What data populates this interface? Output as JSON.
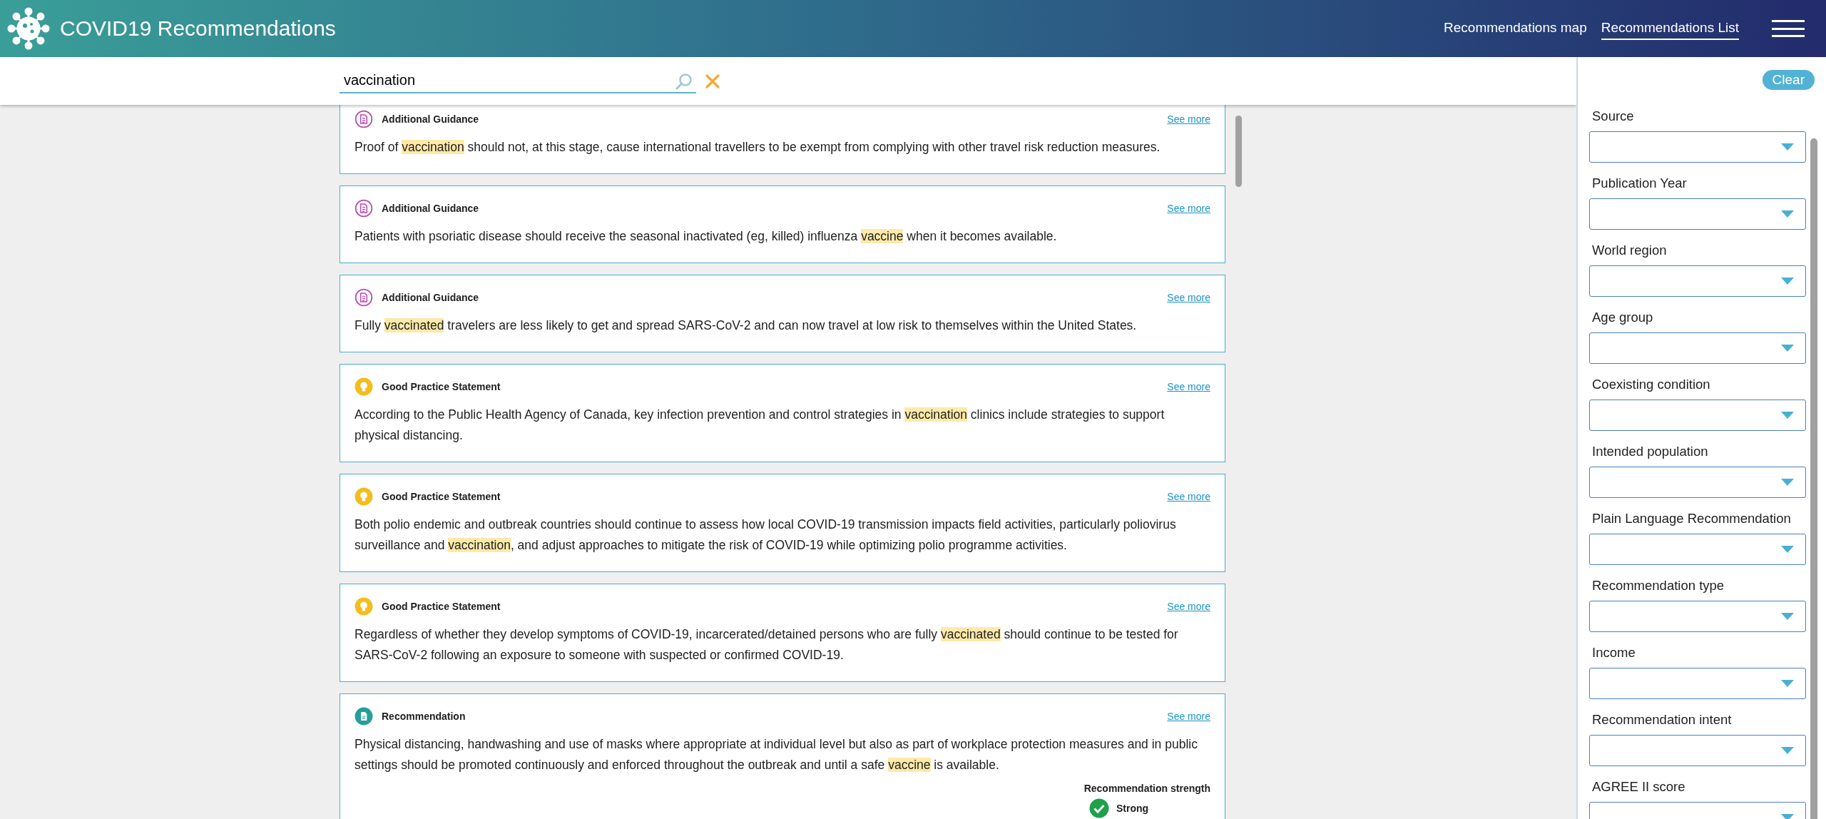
{
  "header": {
    "title": "COVID19 Recommendations",
    "nav": [
      {
        "label": "Recommendations map",
        "selected": false
      },
      {
        "label": "Recommendations List",
        "selected": true
      }
    ]
  },
  "search": {
    "value": "vaccination"
  },
  "cards": [
    {
      "kind": "additional_guidance",
      "type_label": "Additional Guidance",
      "link": "See more",
      "segments": [
        {
          "text": "Proof of ",
          "highlighted": false
        },
        {
          "text": "vaccination",
          "highlighted": true
        },
        {
          "text": " should not, at this stage, cause international travellers to be exempt from complying with other travel risk reduction measures.",
          "highlighted": false
        }
      ]
    },
    {
      "kind": "additional_guidance",
      "type_label": "Additional Guidance",
      "link": "See more",
      "segments": [
        {
          "text": "Patients with psoriatic disease should receive the seasonal inactivated (eg, killed) influenza ",
          "highlighted": false
        },
        {
          "text": "vaccine",
          "highlighted": true
        },
        {
          "text": " when it becomes available.",
          "highlighted": false
        }
      ]
    },
    {
      "kind": "additional_guidance",
      "type_label": "Additional Guidance",
      "link": "See more",
      "segments": [
        {
          "text": "Fully ",
          "highlighted": false
        },
        {
          "text": "vaccinated",
          "highlighted": true
        },
        {
          "text": " travelers are less likely to get and spread SARS-CoV-2 and can now travel at low risk to themselves within the United States.",
          "highlighted": false
        }
      ]
    },
    {
      "kind": "good_practice",
      "type_label": "Good Practice Statement",
      "link": "See more",
      "segments": [
        {
          "text": "According to the Public Health Agency of Canada, key infection prevention and control strategies in ",
          "highlighted": false
        },
        {
          "text": "vaccination",
          "highlighted": true
        },
        {
          "text": " clinics include strategies to support physical distancing.",
          "highlighted": false
        }
      ]
    },
    {
      "kind": "good_practice",
      "type_label": "Good Practice Statement",
      "link": "See more",
      "segments": [
        {
          "text": "Both polio endemic and outbreak countries should continue to assess how local COVID-19 transmission impacts field activities, particularly poliovirus surveillance and ",
          "highlighted": false
        },
        {
          "text": "vaccination",
          "highlighted": true
        },
        {
          "text": ", and adjust approaches to mitigate the risk of COVID-19 while optimizing polio programme activities.",
          "highlighted": false
        }
      ]
    },
    {
      "kind": "good_practice",
      "type_label": "Good Practice Statement",
      "link": "See more",
      "segments": [
        {
          "text": "Regardless of whether they develop symptoms of COVID-19, incarcerated/detained persons who are fully ",
          "highlighted": false
        },
        {
          "text": "vaccinated",
          "highlighted": true
        },
        {
          "text": " should continue to be tested for SARS-CoV-2 following an exposure to someone with suspected or confirmed COVID-19.",
          "highlighted": false
        }
      ]
    },
    {
      "kind": "recommendation",
      "type_label": "Recommendation",
      "link": "See more",
      "segments": [
        {
          "text": "Physical distancing, handwashing and use of masks where appropriate at individual level but also as part of workplace protection measures and in public settings should be promoted continuously and enforced throughout the outbreak and until a safe ",
          "highlighted": false
        },
        {
          "text": "vaccine",
          "highlighted": true
        },
        {
          "text": " is available.",
          "highlighted": false
        }
      ],
      "strength": {
        "label": "Recommendation strength",
        "value": "Strong"
      }
    }
  ],
  "filters": {
    "clear": "Clear",
    "fields": [
      "Source",
      "Publication Year",
      "World region",
      "Age group",
      "Coexisting condition",
      "Intended population",
      "Plain Language Recommendation",
      "Recommendation type",
      "Income",
      "Recommendation intent",
      "AGREE II score"
    ]
  }
}
